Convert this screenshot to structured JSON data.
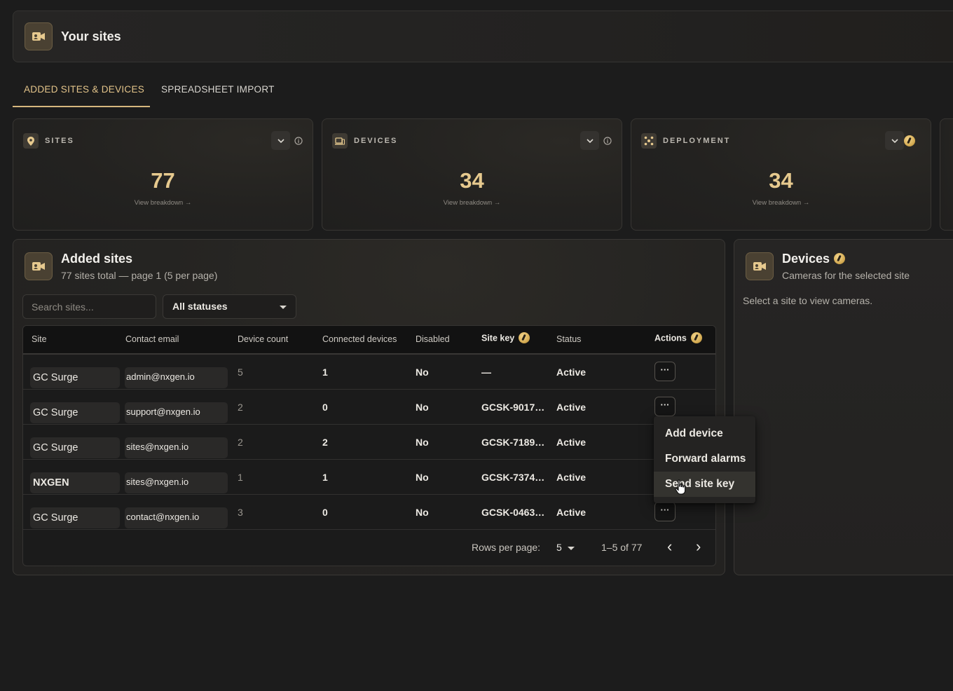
{
  "header": {
    "title": "Your sites",
    "icon": "video-camera-icon"
  },
  "tabs": [
    {
      "label": "ADDED SITES & DEVICES",
      "active": true
    },
    {
      "label": "SPREADSHEET IMPORT",
      "active": false
    }
  ],
  "stats": [
    {
      "label": "SITES",
      "value": "77",
      "link": "View breakdown →",
      "icon": "location-pin-icon"
    },
    {
      "label": "DEVICES",
      "value": "34",
      "link": "View breakdown →",
      "icon": "devices-icon"
    },
    {
      "label": "DEPLOYMENT",
      "value": "34",
      "link": "View breakdown →",
      "icon": "deployment-icon"
    }
  ],
  "sites_panel": {
    "title": "Added sites",
    "subtitle": "77 sites total — page 1 (5 per page)",
    "search_placeholder": "Search sites...",
    "status_filter": "All statuses",
    "columns": [
      "Site",
      "Contact email",
      "Device count",
      "Connected devices",
      "Disabled",
      "Site key",
      "Status",
      "Actions"
    ],
    "rows": [
      {
        "site": "GC Surge",
        "email": "admin@nxgen.io",
        "device_count": "5",
        "connected": "1",
        "disabled": "No",
        "site_key": "—",
        "status": "Active"
      },
      {
        "site": "GC Surge",
        "email": "support@nxgen.io",
        "device_count": "2",
        "connected": "0",
        "disabled": "No",
        "site_key": "GCSK-9017…",
        "status": "Active"
      },
      {
        "site": "GC Surge",
        "email": "sites@nxgen.io",
        "device_count": "2",
        "connected": "2",
        "disabled": "No",
        "site_key": "GCSK-7189…",
        "status": "Active"
      },
      {
        "site": "NXGEN",
        "email": "sites@nxgen.io",
        "device_count": "1",
        "connected": "1",
        "disabled": "No",
        "site_key": "GCSK-7374…",
        "status": "Active"
      },
      {
        "site": "GC Surge",
        "email": "contact@nxgen.io",
        "device_count": "3",
        "connected": "0",
        "disabled": "No",
        "site_key": "GCSK-0463…",
        "status": "Active"
      }
    ],
    "action_label": "···",
    "rows_per_page_label": "Rows per page:",
    "rows_per_page_value": "5",
    "range": "1–5 of 77",
    "prev": "‹",
    "next": "›"
  },
  "devices_panel": {
    "title": "Devices",
    "subtitle": "Cameras for the selected site",
    "empty": "Select a site to view cameras."
  },
  "menu": {
    "items": [
      "Add device",
      "Forward alarms",
      "Send site key"
    ],
    "hovered": "Send site key"
  },
  "colors": {
    "accent": "#e6c98e",
    "tab_active": "#e3c48a",
    "background": "#1c1c1c"
  }
}
